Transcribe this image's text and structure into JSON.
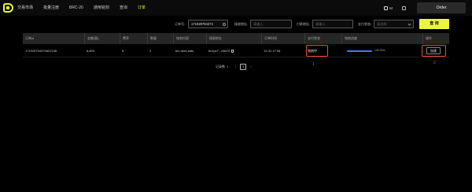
{
  "nav": {
    "items": [
      "交易市场",
      "批量注册",
      "BRC-20",
      "通用铭刻",
      "查询",
      "订单"
    ],
    "active_index": 5,
    "lang_label": "M",
    "order_label": "Order"
  },
  "filters": {
    "order_label": "订单号:",
    "order_value": "171929794374",
    "recv_label": "接收地址:",
    "recv_placeholder": "请输入",
    "pay_label": "付款地址:",
    "pay_placeholder": "请输入",
    "status_label": "支付状态:",
    "status_placeholder": "请选择",
    "query_label": "查 询"
  },
  "table": {
    "headers": [
      "订单id",
      "金额(聪)",
      "费率",
      "数量",
      "铭刻内容",
      "接收地址",
      "订单时间",
      "支付状态",
      "铭刻进度",
      "操作"
    ],
    "rows": [
      {
        "id": "171929794374621248",
        "amount": "6,600",
        "fee": "9",
        "quantity": "2",
        "content": "brc-mint-sats",
        "address": "bc1pv7...n6h70",
        "time": "12-31 17:06",
        "status": "铭刻中",
        "progress_percent": 100,
        "progress_label": "100.00%",
        "action": "加速"
      }
    ]
  },
  "annotations": {
    "status_marker": "1",
    "action_marker": "2"
  },
  "pagination": {
    "total_label": "记录数: 1",
    "prev": "‹",
    "page": "1",
    "next": "›"
  },
  "colors": {
    "accent": "#e8f542",
    "highlight_box": "#e84e3c",
    "progress": "#3d7cf2"
  }
}
